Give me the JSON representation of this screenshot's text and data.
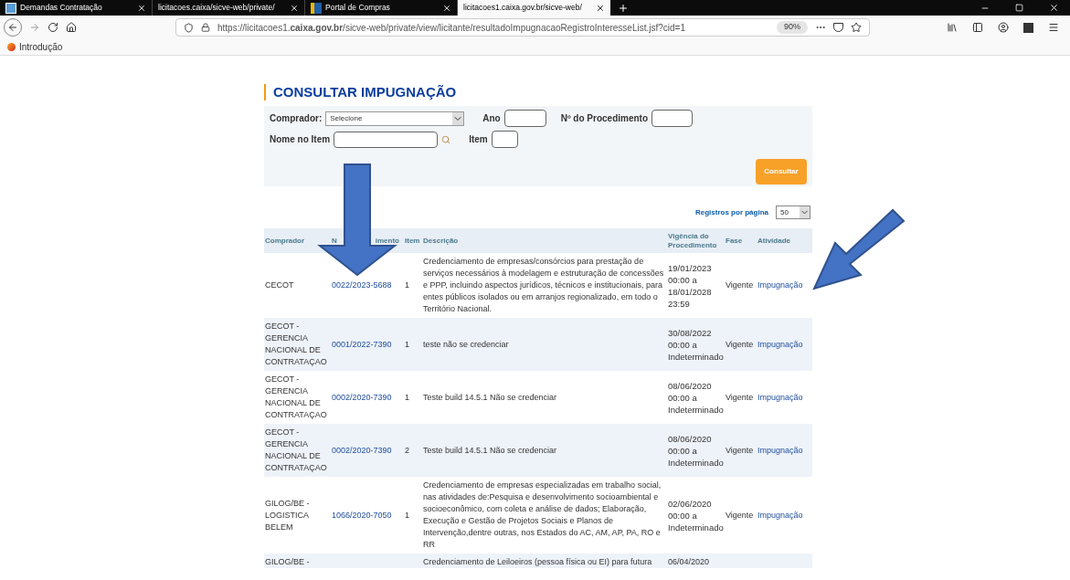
{
  "browser": {
    "tabs": [
      {
        "title": "Demandas Contratação",
        "selected": false
      },
      {
        "title": "licitacoes.caixa/sicve-web/private/",
        "selected": false
      },
      {
        "title": "Portal de Compras",
        "selected": false
      },
      {
        "title": "licitacoes1.caixa.gov.br/sicve-web/",
        "selected": true
      }
    ],
    "url": "https://licitacoes1.**caixa.gov.br**/sicve-web/private/view/licitante/resultadoImpugnacaoRegistroInteresseList.jsf?cid=1",
    "zoom": "90%",
    "bookmarks": [
      "Introdução"
    ]
  },
  "page": {
    "title": "CONSULTAR IMPUGNAÇÃO",
    "filters": {
      "comprador_label": "Comprador:",
      "comprador_value": "Selecione",
      "ano_label": "Ano",
      "procedimento_label": "Nº do Procedimento",
      "nome_label": "Nome no Item",
      "item_label": "Item",
      "button": "Consultar"
    },
    "per_page_label": "Registros por página",
    "per_page_value": "50",
    "table": {
      "columns": [
        [
          "Comprador"
        ],
        [
          "N",
          "imento"
        ],
        [
          "Item"
        ],
        [
          "Descrição"
        ],
        [
          "Vigência do",
          "Procedimento"
        ],
        [
          "Fase"
        ],
        [
          "Atividade"
        ]
      ],
      "rows": [
        {
          "comprador": [
            "CECOT"
          ],
          "procedimento": "0022/2023-5688",
          "item": "1",
          "descricao": "Credenciamento de empresas/consórcios para prestação de serviços necessários à modelagem e estruturação de concessões e PPP, incluindo aspectos jurídicos, técnicos e institucionais, para entes públicos isolados ou em arranjos regionalizado, em todo o Território Nacional.",
          "vigencia": [
            "19/01/2023",
            "00:00 a",
            "18/01/2028",
            "23:59"
          ],
          "fase": "Vigente",
          "atividade": "Impugnação"
        },
        {
          "comprador": [
            "GECOT -",
            "GERENCIA",
            "NACIONAL DE",
            "CONTRATAÇAO"
          ],
          "procedimento": "0001/2022-7390",
          "item": "1",
          "descricao": "teste não se credenciar",
          "vigencia": [
            "30/08/2022",
            "00:00 a",
            "Indeterminado"
          ],
          "fase": "Vigente",
          "atividade": "Impugnação"
        },
        {
          "comprador": [
            "GECOT -",
            "GERENCIA",
            "NACIONAL DE",
            "CONTRATAÇAO"
          ],
          "procedimento": "0002/2020-7390",
          "item": "1",
          "descricao": "Teste build 14.5.1 Não se credenciar",
          "vigencia": [
            "08/06/2020",
            "00:00 a",
            "Indeterminado"
          ],
          "fase": "Vigente",
          "atividade": "Impugnação"
        },
        {
          "comprador": [
            "GECOT -",
            "GERENCIA",
            "NACIONAL DE",
            "CONTRATAÇAO"
          ],
          "procedimento": "0002/2020-7390",
          "item": "2",
          "descricao": "Teste build 14.5.1 Não se credenciar",
          "vigencia": [
            "08/06/2020",
            "00:00 a",
            "Indeterminado"
          ],
          "fase": "Vigente",
          "atividade": "Impugnação"
        },
        {
          "comprador": [
            "GILOG/BE -",
            "LOGISTICA",
            "BELEM"
          ],
          "procedimento": "1066/2020-7050",
          "item": "1",
          "descricao": "Credenciamento de empresas especializadas em trabalho social, nas atividades de:Pesquisa e desenvolvimento socioambiental e socioeconômico, com coleta e análise de dados; Elaboração, Execução e Gestão de Projetos Sociais e Planos de Intervenção,dentre outras, nos Estados do AC, AM, AP, PA, RO e RR",
          "vigencia": [
            "02/06/2020",
            "00:00 a",
            "Indeterminado"
          ],
          "fase": "Vigente",
          "atividade": "Impugnação"
        }
      ],
      "partial_row": {
        "comprador": "GILOG/BE -",
        "descricao": "Credenciamento de Leiloeiros (pessoa física ou EI) para futura",
        "vigencia": "06/04/2020"
      }
    }
  },
  "annotations": [
    {
      "kind": "down-arrow"
    },
    {
      "kind": "diagonal-arrow"
    }
  ]
}
